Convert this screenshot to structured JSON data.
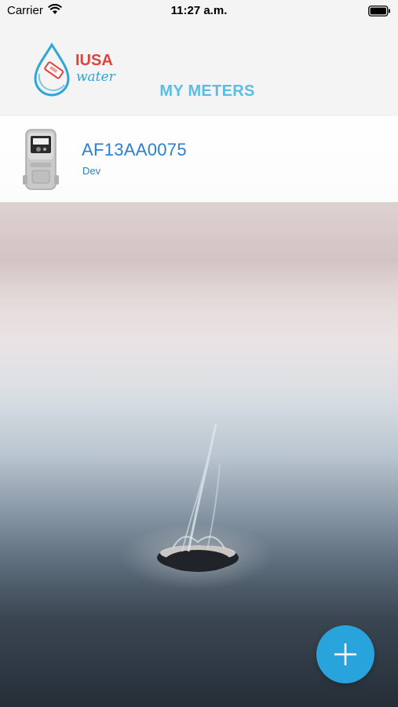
{
  "status_bar": {
    "carrier": "Carrier",
    "time": "11:27 a.m.",
    "icons": [
      "wifi-icon",
      "battery-icon"
    ]
  },
  "header": {
    "logo_brand": "IUSA",
    "logo_sub": "water",
    "title": "MY METERS"
  },
  "meters": [
    {
      "id": "AF13AA0075",
      "environment": "Dev",
      "icon": "water-meter-icon"
    }
  ],
  "fab": {
    "icon": "plus-icon"
  },
  "colors": {
    "accent": "#29a3dc",
    "title": "#5bbce5",
    "meter_text": "#2a7fd4",
    "brand_red": "#e0423c"
  }
}
